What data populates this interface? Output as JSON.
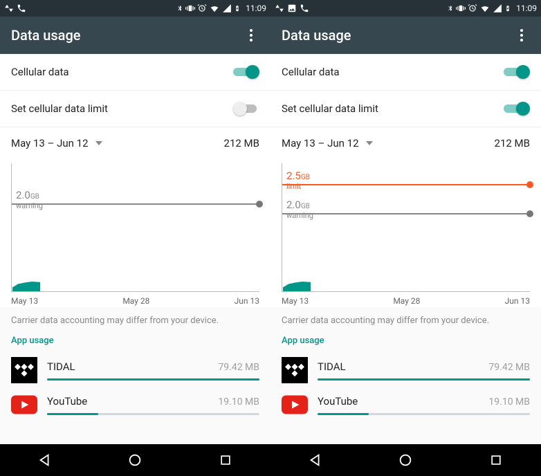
{
  "status": {
    "time": "11:09",
    "icons_left": [
      "network-activity-icon",
      "gallery-icon",
      "call-icon"
    ],
    "icons_right": [
      "bluetooth-icon",
      "vibrate-icon",
      "alarm-icon",
      "wifi-icon",
      "signal-icon",
      "battery-charging-icon"
    ]
  },
  "header": {
    "title": "Data usage"
  },
  "rows": {
    "cellular_label": "Cellular data",
    "limit_label": "Set cellular data limit"
  },
  "cycle": {
    "range": "May 13 – Jun 12",
    "total": "212 MB"
  },
  "graph": {
    "warn_value": "2.0",
    "warn_unit": "GB",
    "warn_caption": "warning",
    "limit_value": "2.5",
    "limit_unit": "GB",
    "limit_caption": "limit",
    "ticks": [
      "May 13",
      "May 28",
      "Jun 13"
    ]
  },
  "disclaimer": "Carrier data accounting may differ from your device.",
  "section": "App usage",
  "apps": [
    {
      "name": "TIDAL",
      "value": "79.42 MB",
      "pct": 100
    },
    {
      "name": "YouTube",
      "value": "19.10 MB",
      "pct": 24
    }
  ],
  "left": {
    "limit_toggle_on": false,
    "show_limit_line": false
  },
  "right": {
    "limit_toggle_on": true,
    "show_limit_line": true
  },
  "chart_data": {
    "type": "area",
    "title": "Cellular data usage",
    "xlabel": "",
    "ylabel": "",
    "x_range": [
      "May 13",
      "Jun 13"
    ],
    "x_ticks": [
      "May 13",
      "May 28",
      "Jun 13"
    ],
    "y_unit": "GB",
    "warning_gb": 2.0,
    "limit_gb": 2.5,
    "series": [
      {
        "name": "usage_gb",
        "x": [
          "May 13",
          "May 14",
          "May 15",
          "May 16",
          "May 17"
        ],
        "values": [
          0.02,
          0.08,
          0.14,
          0.18,
          0.21
        ]
      }
    ],
    "cycle_total_mb": 212
  }
}
